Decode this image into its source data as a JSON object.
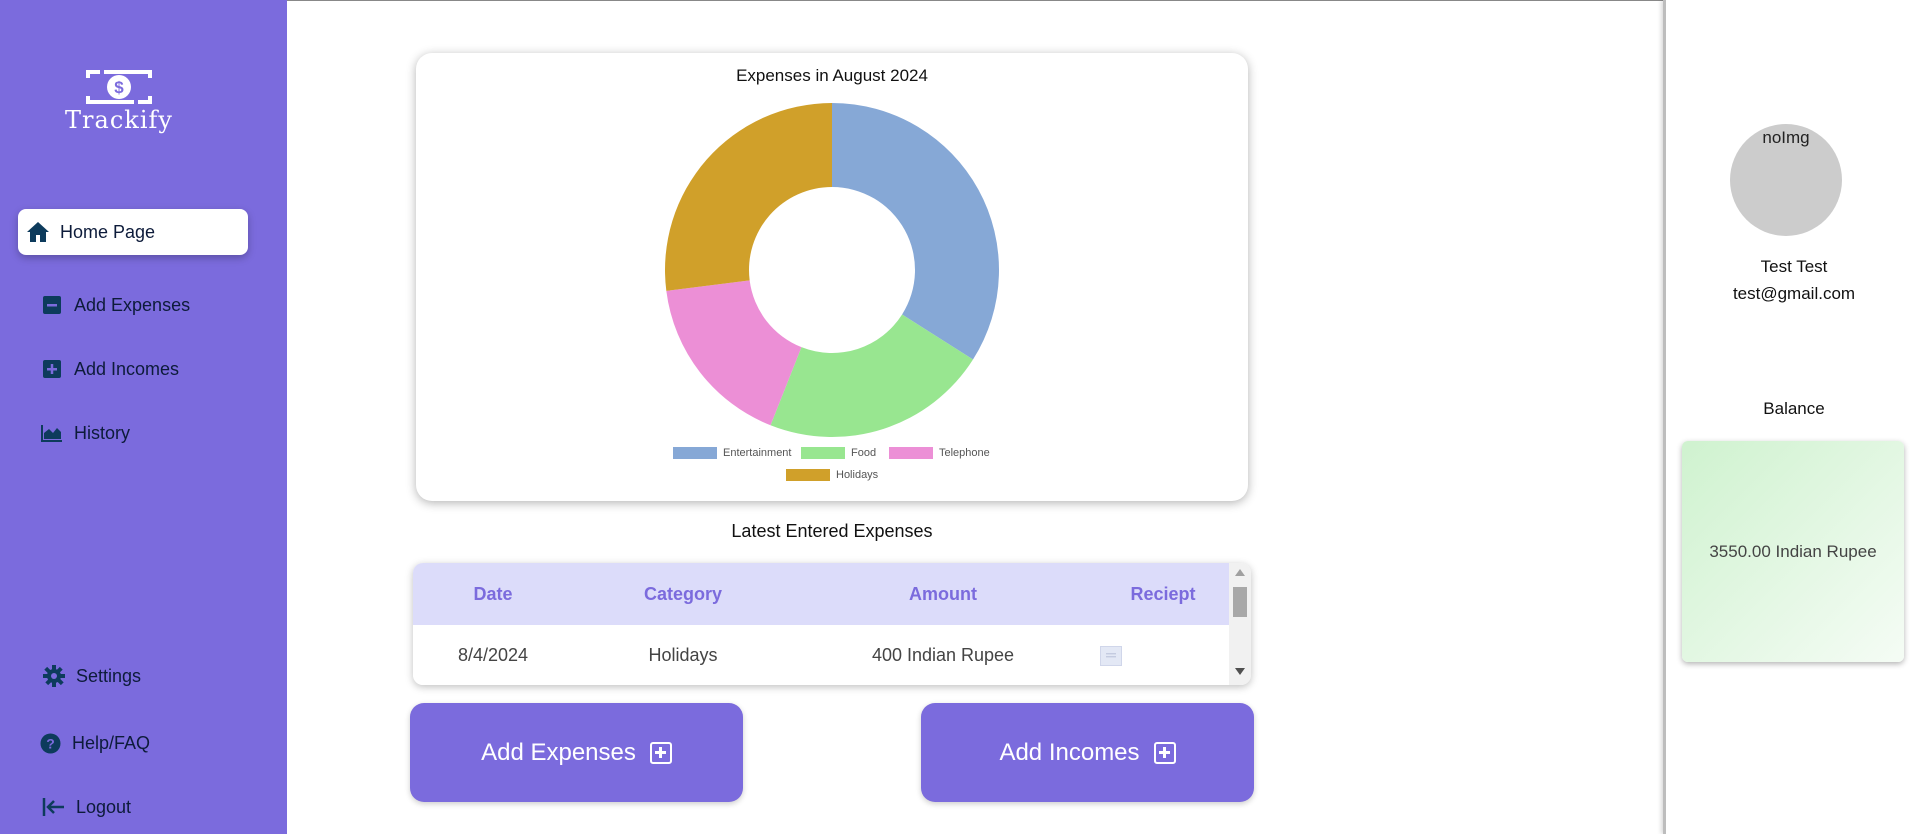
{
  "app": {
    "logo_text": "Trackify"
  },
  "sidebar": {
    "items": [
      {
        "label": "Home Page",
        "icon": "home-icon"
      },
      {
        "label": "Add Expenses",
        "icon": "minus-square-icon"
      },
      {
        "label": "Add Incomes",
        "icon": "plus-square-icon"
      },
      {
        "label": "History",
        "icon": "area-chart-icon"
      },
      {
        "label": "Settings",
        "icon": "gear-icon"
      },
      {
        "label": "Help/FAQ",
        "icon": "question-circle-icon"
      },
      {
        "label": "Logout",
        "icon": "logout-icon"
      }
    ]
  },
  "colors": {
    "sidebar": "#7b6bdd",
    "accent": "#7b6bdd",
    "table_header": "#dcdcfa",
    "nav_text": "#0d1b3a"
  },
  "chart_data": {
    "type": "pie",
    "title": "Expenses in August 2024",
    "categories": [
      "Entertainment",
      "Food",
      "Telephone",
      "Holidays"
    ],
    "values": [
      34,
      22,
      17,
      27
    ],
    "colors": [
      "#86a8d6",
      "#98e690",
      "#ec8fd6",
      "#d0a02a"
    ],
    "legend_position": "bottom",
    "donut": true
  },
  "latest": {
    "title": "Latest Entered Expenses",
    "columns": [
      "Date",
      "Category",
      "Amount",
      "Reciept"
    ],
    "rows": [
      {
        "date": "8/4/2024",
        "category": "Holidays",
        "amount": "400 Indian Rupee"
      }
    ]
  },
  "buttons": {
    "add_expenses": "Add Expenses",
    "add_incomes": "Add Incomes"
  },
  "user": {
    "avatar_alt": "noImg",
    "name": "Test Test",
    "email": "test@gmail.com",
    "balance_label": "Balance",
    "balance_value": "3550.00 Indian Rupee"
  }
}
